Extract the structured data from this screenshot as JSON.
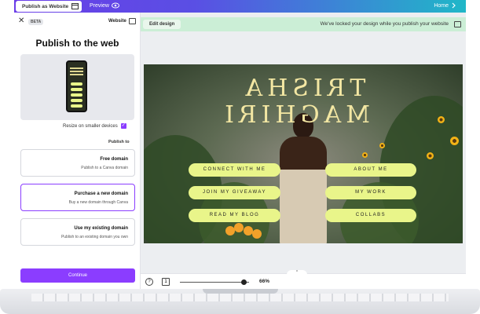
{
  "topbar": {
    "publish_label": "Publish as Website",
    "preview_label": "Preview",
    "home_label": "Home"
  },
  "panel": {
    "header_label": "Website",
    "beta_badge": "BETA",
    "title": "Publish to the web",
    "resize_label": "Resize on smaller devices",
    "publish_to_label": "Publish to",
    "options": [
      {
        "title": "Free domain",
        "subtitle": "Publish to a Canva domain"
      },
      {
        "title": "Purchase a new domain",
        "subtitle": "Buy a new domain through Canva"
      },
      {
        "title": "Use my existing domain",
        "subtitle": "Publish to an existing domain you own"
      }
    ],
    "continue_label": "Continue"
  },
  "canvas": {
    "edit_design_label": "Edit design",
    "notice_text": "We've locked your design while you publish your website",
    "design_title": "TRISHA\nMAGHIRI",
    "buttons": [
      "CONNECT WITH ME",
      "ABOUT ME",
      "JOIN MY GIVEAWAY",
      "MY WORK",
      "READ MY BLOG",
      "COLLABS"
    ],
    "zoom": "66%",
    "page_count": "1",
    "help": "?"
  },
  "colors": {
    "accent": "#8b3dff",
    "pill": "#e9f58a",
    "notice_bg": "#cbeed6"
  }
}
